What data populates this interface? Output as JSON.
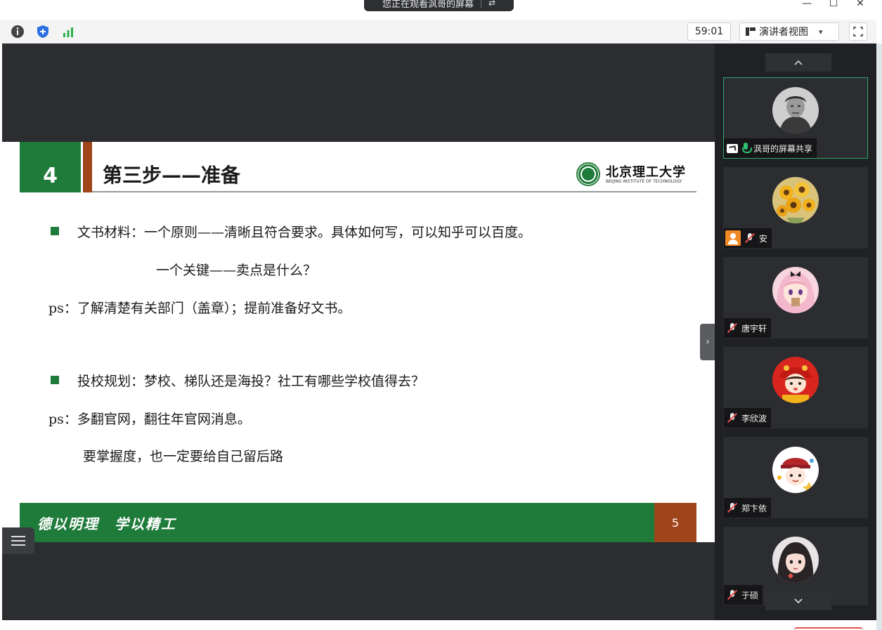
{
  "window": {
    "share_notice": "您正在观看沨哥的屏幕",
    "minimize": "—",
    "maximize": "☐",
    "close": "✕"
  },
  "toolbar": {
    "timer": "59:01",
    "view_mode": "演讲者视图",
    "view_caret": "▾"
  },
  "slide": {
    "section_number": "4",
    "title": "第三步——准备",
    "logo_cn": "北京理工大学",
    "logo_en": "BEIJING INSTITUTE OF TECHNOLOGY",
    "lines": [
      "文书材料：一个原则——清晰且符合要求。具体如何写，可以知乎可以百度。",
      "一个关键——卖点是什么？",
      "ps：了解清楚有关部门（盖章）；提前准备好文书。",
      "投校规划：梦校、梯队还是海投？社工有哪些学校值得去？",
      "ps：多翻官网，翻往年官网消息。",
      "要掌握度，也一定要给自己留后路"
    ],
    "motto": "德以明理　学以精工",
    "page_number": "5"
  },
  "participants": [
    {
      "name": "沨哥的屏幕共享",
      "mic": "on",
      "sharing": true,
      "avatar": "portrait-avatar"
    },
    {
      "name": "安",
      "mic": "off",
      "sharing": false,
      "avatar": "sunflower-avatar"
    },
    {
      "name": "唐宇轩",
      "mic": "off",
      "sharing": false,
      "avatar": "anime-girl-avatar"
    },
    {
      "name": "李欣波",
      "mic": "off",
      "sharing": false,
      "avatar": "red-hat-avatar"
    },
    {
      "name": "郑卞依",
      "mic": "off",
      "sharing": false,
      "avatar": "cartoon-hat-avatar"
    },
    {
      "name": "于硕",
      "mic": "off",
      "sharing": false,
      "avatar": "girl-avatar"
    }
  ],
  "colors": {
    "slide_green": "#1e7b3a",
    "slide_rust": "#a0441b",
    "panel_bg": "#202124",
    "active_border": "#2fa86d"
  }
}
